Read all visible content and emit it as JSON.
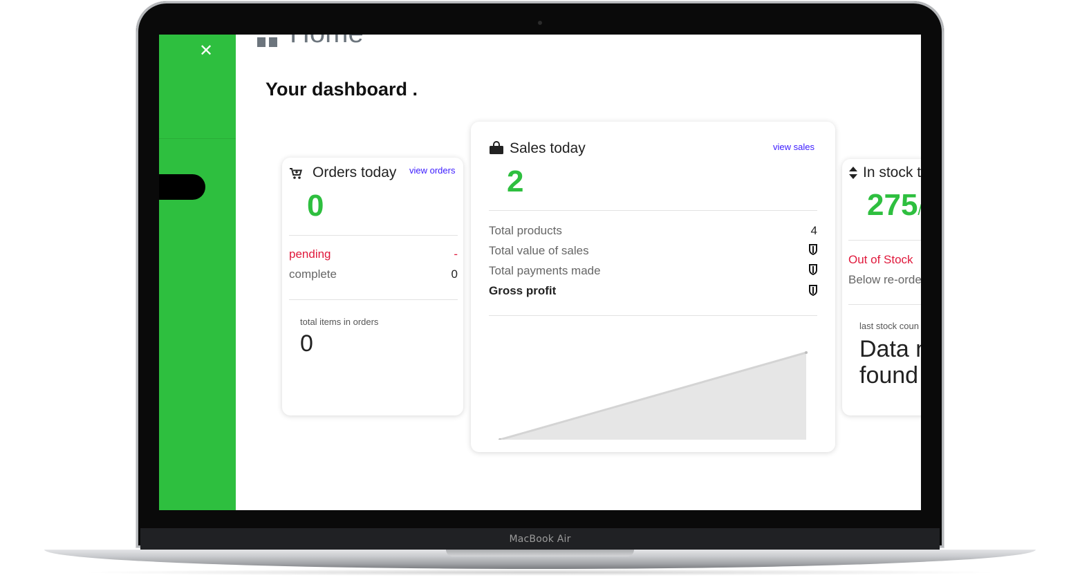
{
  "device": {
    "brand_label": "MacBook Air"
  },
  "sidebar": {
    "close_icon": "close-icon",
    "accent_color": "#2ebf3f"
  },
  "page": {
    "heading": "Home",
    "dashboard_title": "Your dashboard ."
  },
  "orders_card": {
    "icon": "cart-icon",
    "title": "Orders today",
    "link": "view orders",
    "count": "0",
    "rows": [
      {
        "label": "pending",
        "value": "-"
      },
      {
        "label": "complete",
        "value": "0"
      }
    ],
    "footer_label": "total items in orders",
    "footer_value": "0"
  },
  "sales_card": {
    "icon": "shopping-bag-icon",
    "title": "Sales today",
    "link": "view sales",
    "count": "2",
    "rows": [
      {
        "label": "Total products",
        "value": "4"
      },
      {
        "label": "Total value of sales",
        "value_icon": "currency-icon"
      },
      {
        "label": "Total payments made",
        "value_icon": "currency-icon"
      },
      {
        "label": "Gross profit",
        "value_icon": "currency-icon"
      }
    ],
    "chart_data": {
      "type": "area",
      "x": [
        0,
        1
      ],
      "values": [
        0,
        1
      ],
      "fill_color": "#e6e6e6",
      "line_color": "#d4d4d4",
      "title": "",
      "xlabel": "",
      "ylabel": ""
    }
  },
  "stock_card": {
    "icon": "sort-icon",
    "title": "In stock t",
    "count": "275",
    "count_suffix": "/",
    "rows": [
      {
        "label": "Out of Stock"
      },
      {
        "label": "Below re-orde"
      }
    ],
    "footer_label": "last stock coun",
    "footer_value": "Data n\nfound"
  },
  "colors": {
    "pending": "#e0183b",
    "link": "#3a1aff",
    "green": "#2ebf3f"
  }
}
